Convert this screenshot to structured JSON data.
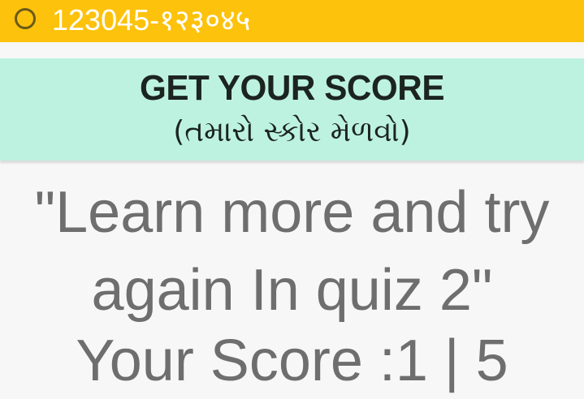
{
  "status_bar": {
    "text": "123045-१२३०४५",
    "icon": "radio-circle-icon",
    "background": "#fdc20c"
  },
  "header": {
    "title": "GET YOUR SCORE",
    "subtitle": "(તમારો સ્કોર મેળવો)",
    "background": "#bdf2e1"
  },
  "result": {
    "message_line1": "\"Learn more and try",
    "message_line2": "again In quiz 2\"",
    "score_text": "Your Score :1 | 5",
    "text_color": "#6e6e6e"
  }
}
